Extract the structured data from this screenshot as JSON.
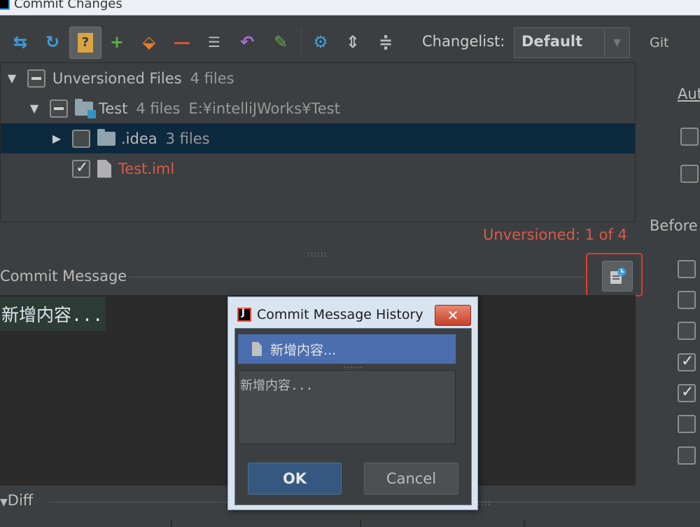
{
  "window": {
    "title": "Commit Changes"
  },
  "toolbar": {
    "changelist_label": "Changelist:",
    "changelist_value": "Default",
    "vcs_label": "Git",
    "icons": [
      "show-diff-icon",
      "refresh-icon",
      "unversioned-files-icon",
      "add-icon",
      "move-to-changelist-icon",
      "remove-icon",
      "group-by-icon",
      "rollback-icon",
      "edit-source-icon",
      "settings-icon",
      "expand-all-icon",
      "collapse-all-icon"
    ]
  },
  "tree": {
    "rows": [
      {
        "label": "Unversioned Files",
        "count": "4 files"
      },
      {
        "label": "Test",
        "count": "4 files",
        "path": "E:¥intelliJWorks¥Test"
      },
      {
        "label": ".idea",
        "count": "3 files"
      },
      {
        "label": "Test.iml"
      }
    ],
    "status": "Unversioned: 1 of 4"
  },
  "commit_message": {
    "label": "Commit Message",
    "text": "新增内容..."
  },
  "diff": {
    "label": "Diff"
  },
  "right_panel": {
    "auto_label": "Aut",
    "before_label": "Before",
    "top_checkboxes": [
      false,
      false
    ],
    "before_checkboxes": [
      false,
      false,
      false,
      true,
      true,
      false,
      false
    ]
  },
  "dialog": {
    "title": "Commit Message History",
    "close_label": "✕",
    "items": [
      "新增内容..."
    ],
    "preview": "新增内容...",
    "ok_label": "OK",
    "cancel_label": "Cancel"
  },
  "colors": {
    "background": "#3c3f41",
    "selection": "#0d293e",
    "unversioned_text": "#d95a4a",
    "highlight_frame": "#e03a2a",
    "dialog_selection": "#4b6eaf",
    "ok_button": "#365880"
  }
}
